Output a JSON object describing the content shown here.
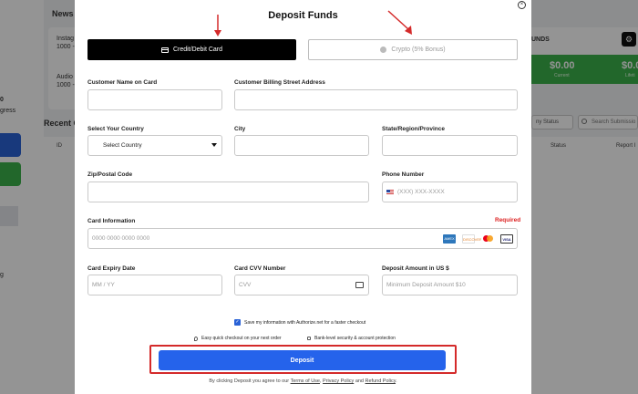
{
  "background": {
    "news_heading": "News A",
    "news_items": [
      "Instag",
      "1000 -",
      "Audio",
      "1000 -"
    ],
    "recent_heading": "Recent C",
    "table_col_id": "ID",
    "table_col_status": "Status",
    "table_col_report": "Report I",
    "side_text_1": "0",
    "side_text_2": "gress",
    "side_text_3": "g",
    "funds_label": "UNDS",
    "amount_1": "$0.00",
    "amount_1_label": "Current",
    "amount_2": "$0.00",
    "amount_2_label": "Lifeti",
    "status_filter": "ny Status",
    "search_placeholder": "Search Submissio"
  },
  "modal": {
    "title": "Deposit Funds",
    "close_glyph": "×",
    "tabs": {
      "card": "Credit/Debit Card",
      "crypto": "Crypto (5% Bonus)"
    },
    "fields": {
      "name_label": "Customer Name on Card",
      "name_value": "",
      "street_label": "Customer Billing Street Address",
      "street_value": "",
      "country_label": "Select Your Country",
      "country_value": "Select Country",
      "city_label": "City",
      "city_value": "",
      "state_label": "State/Region/Province",
      "state_value": "",
      "zip_label": "Zip/Postal Code",
      "zip_value": "",
      "phone_label": "Phone Number",
      "phone_placeholder": "(XXX) XXX-XXXX",
      "card_info_label": "Card Information",
      "required_label": "Required",
      "card_placeholder": "0000 0000 0000 0000",
      "expiry_label": "Card Expiry Date",
      "expiry_placeholder": "MM / YY",
      "cvv_label": "Card CVV Number",
      "cvv_placeholder": "CVV",
      "amount_label": "Deposit Amount in US $",
      "amount_placeholder": "Minimum Deposit Amount $10"
    },
    "card_logos": [
      "AMEX",
      "DISCOVER",
      "",
      "VISA"
    ],
    "save_info": "Save my information with Authorize.net for a faster checkout",
    "perk_1": "Easy quick checkout on your next order",
    "perk_2": "Bank-level security & account protection",
    "deposit_button": "Deposit",
    "terms_prefix": "By clicking Deposit you agree to our",
    "terms_link": "Terms of Use",
    "terms_comma": ",",
    "privacy_link": "Privacy Policy",
    "terms_and": "and",
    "refund_link": "Refund Policy",
    "terms_suffix": "."
  },
  "colors": {
    "accent": "#2563eb",
    "annotation": "#d42a2a",
    "tab_active": "#000000"
  }
}
